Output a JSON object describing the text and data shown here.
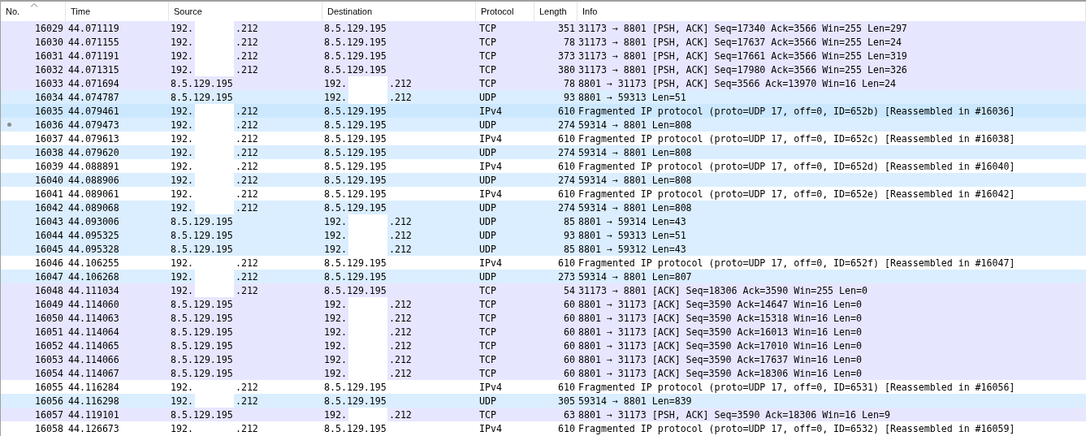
{
  "columns": [
    {
      "label": "No.",
      "sorted": true
    },
    {
      "label": "Time",
      "sorted": false
    },
    {
      "label": "Source",
      "sorted": false
    },
    {
      "label": "Destination",
      "sorted": false
    },
    {
      "label": "Protocol",
      "sorted": false
    },
    {
      "label": "Length",
      "sorted": false
    },
    {
      "label": "Info",
      "sorted": false
    }
  ],
  "rows": [
    {
      "no": "16029",
      "time": "44.071119",
      "source": {
        "start": "192.",
        "end": ".212"
      },
      "destination": {
        "text": "8.5.129.195"
      },
      "protocol": "TCP",
      "length": "351",
      "info": "31173 → 8801 [PSH, ACK] Seq=17340 Ack=3566 Win=255 Len=297",
      "color": "#e7e6ff",
      "related": false
    },
    {
      "no": "16030",
      "time": "44.071155",
      "source": {
        "start": "192.",
        "end": ".212"
      },
      "destination": {
        "text": "8.5.129.195"
      },
      "protocol": "TCP",
      "length": "78",
      "info": "31173 → 8801 [PSH, ACK] Seq=17637 Ack=3566 Win=255 Len=24",
      "color": "#e7e6ff",
      "related": false
    },
    {
      "no": "16031",
      "time": "44.071191",
      "source": {
        "start": "192.",
        "end": ".212"
      },
      "destination": {
        "text": "8.5.129.195"
      },
      "protocol": "TCP",
      "length": "373",
      "info": "31173 → 8801 [PSH, ACK] Seq=17661 Ack=3566 Win=255 Len=319",
      "color": "#e7e6ff",
      "related": false
    },
    {
      "no": "16032",
      "time": "44.071315",
      "source": {
        "start": "192.",
        "end": ".212"
      },
      "destination": {
        "text": "8.5.129.195"
      },
      "protocol": "TCP",
      "length": "380",
      "info": "31173 → 8801 [PSH, ACK] Seq=17980 Ack=3566 Win=255 Len=326",
      "color": "#e7e6ff",
      "related": false
    },
    {
      "no": "16033",
      "time": "44.071694",
      "source": {
        "text": "8.5.129.195"
      },
      "destination": {
        "start": "192.",
        "end": ".212"
      },
      "protocol": "TCP",
      "length": "78",
      "info": "8801 → 31173 [PSH, ACK] Seq=3566 Ack=13970 Win=16 Len=24",
      "color": "#e7e6ff",
      "related": false
    },
    {
      "no": "16034",
      "time": "44.074787",
      "source": {
        "text": "8.5.129.195"
      },
      "destination": {
        "start": "192.",
        "end": ".212"
      },
      "protocol": "UDP",
      "length": "93",
      "info": "8801 → 59313 Len=51",
      "color": "#daeeff",
      "related": false
    },
    {
      "no": "16035",
      "time": "44.079461",
      "source": {
        "start": "192.",
        "end": ".212"
      },
      "destination": {
        "text": "8.5.129.195"
      },
      "protocol": "IPv4",
      "length": "610",
      "info": "Fragmented IP protocol (proto=UDP 17, off=0, ID=652b) [Reassembled in #16036]",
      "color": "#cce8ff",
      "related": false
    },
    {
      "no": "16036",
      "time": "44.079473",
      "source": {
        "start": "192.",
        "end": ".212"
      },
      "destination": {
        "text": "8.5.129.195"
      },
      "protocol": "UDP",
      "length": "274",
      "info": "59314 → 8801 Len=808",
      "color": "#daeeff",
      "related": true
    },
    {
      "no": "16037",
      "time": "44.079613",
      "source": {
        "start": "192.",
        "end": ".212"
      },
      "destination": {
        "text": "8.5.129.195"
      },
      "protocol": "IPv4",
      "length": "610",
      "info": "Fragmented IP protocol (proto=UDP 17, off=0, ID=652c) [Reassembled in #16038]",
      "color": "#ffffff",
      "related": false
    },
    {
      "no": "16038",
      "time": "44.079620",
      "source": {
        "start": "192.",
        "end": ".212"
      },
      "destination": {
        "text": "8.5.129.195"
      },
      "protocol": "UDP",
      "length": "274",
      "info": "59314 → 8801 Len=808",
      "color": "#daeeff",
      "related": false
    },
    {
      "no": "16039",
      "time": "44.088891",
      "source": {
        "start": "192.",
        "end": ".212"
      },
      "destination": {
        "text": "8.5.129.195"
      },
      "protocol": "IPv4",
      "length": "610",
      "info": "Fragmented IP protocol (proto=UDP 17, off=0, ID=652d) [Reassembled in #16040]",
      "color": "#ffffff",
      "related": false
    },
    {
      "no": "16040",
      "time": "44.088906",
      "source": {
        "start": "192.",
        "end": ".212"
      },
      "destination": {
        "text": "8.5.129.195"
      },
      "protocol": "UDP",
      "length": "274",
      "info": "59314 → 8801 Len=808",
      "color": "#daeeff",
      "related": false
    },
    {
      "no": "16041",
      "time": "44.089061",
      "source": {
        "start": "192.",
        "end": ".212"
      },
      "destination": {
        "text": "8.5.129.195"
      },
      "protocol": "IPv4",
      "length": "610",
      "info": "Fragmented IP protocol (proto=UDP 17, off=0, ID=652e) [Reassembled in #16042]",
      "color": "#ffffff",
      "related": false
    },
    {
      "no": "16042",
      "time": "44.089068",
      "source": {
        "start": "192.",
        "end": ".212"
      },
      "destination": {
        "text": "8.5.129.195"
      },
      "protocol": "UDP",
      "length": "274",
      "info": "59314 → 8801 Len=808",
      "color": "#daeeff",
      "related": false
    },
    {
      "no": "16043",
      "time": "44.093006",
      "source": {
        "text": "8.5.129.195"
      },
      "destination": {
        "start": "192.",
        "end": ".212"
      },
      "protocol": "UDP",
      "length": "85",
      "info": "8801 → 59314 Len=43",
      "color": "#daeeff",
      "related": false
    },
    {
      "no": "16044",
      "time": "44.095325",
      "source": {
        "text": "8.5.129.195"
      },
      "destination": {
        "start": "192.",
        "end": ".212"
      },
      "protocol": "UDP",
      "length": "93",
      "info": "8801 → 59313 Len=51",
      "color": "#daeeff",
      "related": false
    },
    {
      "no": "16045",
      "time": "44.095328",
      "source": {
        "text": "8.5.129.195"
      },
      "destination": {
        "start": "192.",
        "end": ".212"
      },
      "protocol": "UDP",
      "length": "85",
      "info": "8801 → 59312 Len=43",
      "color": "#daeeff",
      "related": false
    },
    {
      "no": "16046",
      "time": "44.106255",
      "source": {
        "start": "192.",
        "end": ".212"
      },
      "destination": {
        "text": "8.5.129.195"
      },
      "protocol": "IPv4",
      "length": "610",
      "info": "Fragmented IP protocol (proto=UDP 17, off=0, ID=652f) [Reassembled in #16047]",
      "color": "#ffffff",
      "related": false
    },
    {
      "no": "16047",
      "time": "44.106268",
      "source": {
        "start": "192.",
        "end": ".212"
      },
      "destination": {
        "text": "8.5.129.195"
      },
      "protocol": "UDP",
      "length": "273",
      "info": "59314 → 8801 Len=807",
      "color": "#daeeff",
      "related": false
    },
    {
      "no": "16048",
      "time": "44.111034",
      "source": {
        "start": "192.",
        "end": ".212"
      },
      "destination": {
        "text": "8.5.129.195"
      },
      "protocol": "TCP",
      "length": "54",
      "info": "31173 → 8801 [ACK] Seq=18306 Ack=3590 Win=255 Len=0",
      "color": "#e7e6ff",
      "related": false
    },
    {
      "no": "16049",
      "time": "44.114060",
      "source": {
        "text": "8.5.129.195"
      },
      "destination": {
        "start": "192.",
        "end": ".212"
      },
      "protocol": "TCP",
      "length": "60",
      "info": "8801 → 31173 [ACK] Seq=3590 Ack=14647 Win=16 Len=0",
      "color": "#e7e6ff",
      "related": false
    },
    {
      "no": "16050",
      "time": "44.114063",
      "source": {
        "text": "8.5.129.195"
      },
      "destination": {
        "start": "192.",
        "end": ".212"
      },
      "protocol": "TCP",
      "length": "60",
      "info": "8801 → 31173 [ACK] Seq=3590 Ack=15318 Win=16 Len=0",
      "color": "#e7e6ff",
      "related": false
    },
    {
      "no": "16051",
      "time": "44.114064",
      "source": {
        "text": "8.5.129.195"
      },
      "destination": {
        "start": "192.",
        "end": ".212"
      },
      "protocol": "TCP",
      "length": "60",
      "info": "8801 → 31173 [ACK] Seq=3590 Ack=16013 Win=16 Len=0",
      "color": "#e7e6ff",
      "related": false
    },
    {
      "no": "16052",
      "time": "44.114065",
      "source": {
        "text": "8.5.129.195"
      },
      "destination": {
        "start": "192.",
        "end": ".212"
      },
      "protocol": "TCP",
      "length": "60",
      "info": "8801 → 31173 [ACK] Seq=3590 Ack=17010 Win=16 Len=0",
      "color": "#e7e6ff",
      "related": false
    },
    {
      "no": "16053",
      "time": "44.114066",
      "source": {
        "text": "8.5.129.195"
      },
      "destination": {
        "start": "192.",
        "end": ".212"
      },
      "protocol": "TCP",
      "length": "60",
      "info": "8801 → 31173 [ACK] Seq=3590 Ack=17637 Win=16 Len=0",
      "color": "#e7e6ff",
      "related": false
    },
    {
      "no": "16054",
      "time": "44.114067",
      "source": {
        "text": "8.5.129.195"
      },
      "destination": {
        "start": "192.",
        "end": ".212"
      },
      "protocol": "TCP",
      "length": "60",
      "info": "8801 → 31173 [ACK] Seq=3590 Ack=18306 Win=16 Len=0",
      "color": "#e7e6ff",
      "related": false
    },
    {
      "no": "16055",
      "time": "44.116284",
      "source": {
        "start": "192.",
        "end": ".212"
      },
      "destination": {
        "text": "8.5.129.195"
      },
      "protocol": "IPv4",
      "length": "610",
      "info": "Fragmented IP protocol (proto=UDP 17, off=0, ID=6531) [Reassembled in #16056]",
      "color": "#ffffff",
      "related": false
    },
    {
      "no": "16056",
      "time": "44.116298",
      "source": {
        "start": "192.",
        "end": ".212"
      },
      "destination": {
        "text": "8.5.129.195"
      },
      "protocol": "UDP",
      "length": "305",
      "info": "59314 → 8801 Len=839",
      "color": "#daeeff",
      "related": false
    },
    {
      "no": "16057",
      "time": "44.119101",
      "source": {
        "text": "8.5.129.195"
      },
      "destination": {
        "start": "192.",
        "end": ".212"
      },
      "protocol": "TCP",
      "length": "63",
      "info": "8801 → 31173 [PSH, ACK] Seq=3590 Ack=18306 Win=16 Len=9",
      "color": "#e7e6ff",
      "related": false
    },
    {
      "no": "16058",
      "time": "44.126673",
      "source": {
        "start": "192.",
        "end": ".212"
      },
      "destination": {
        "text": "8.5.129.195"
      },
      "protocol": "IPv4",
      "length": "610",
      "info": "Fragmented IP protocol (proto=UDP 17, off=0, ID=6532) [Reassembled in #16059]",
      "color": "#ffffff",
      "related": false
    }
  ]
}
